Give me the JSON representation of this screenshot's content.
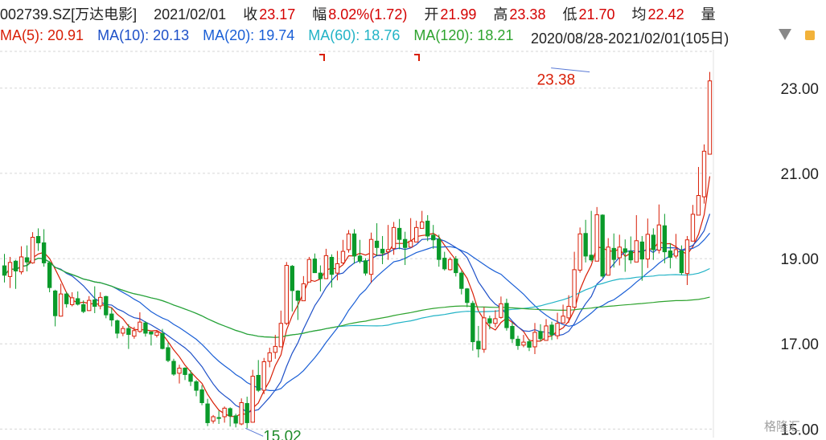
{
  "header": {
    "symbol": "002739.SZ[万达电影]",
    "date": "2021/02/01",
    "close_label": "收",
    "close": "23.17",
    "change_label": "幅",
    "change": "8.02%(1.72)",
    "open_label": "开",
    "open": "21.99",
    "high_label": "高",
    "high": "23.38",
    "low_label": "低",
    "low": "21.70",
    "avg_label": "均",
    "avg": "22.42",
    "volume_label": "量"
  },
  "moving_averages": [
    {
      "label": "MA(5):",
      "value": "20.91",
      "color": "#d81e06"
    },
    {
      "label": "MA(10):",
      "value": "20.13",
      "color": "#1e50c8"
    },
    {
      "label": "MA(20):",
      "value": "19.74",
      "color": "#1a5fd6"
    },
    {
      "label": "MA(60):",
      "value": "18.76",
      "color": "#22b3c6"
    },
    {
      "label": "MA(120):",
      "value": "18.21",
      "color": "#2ea32e"
    }
  ],
  "range": {
    "text": "2020/08/28-2021/02/01(105日)"
  },
  "watermark": "格隆汇",
  "chart_data": {
    "type": "candlestick",
    "y_ticks": [
      "23.00",
      "21.00",
      "19.00",
      "17.00",
      "15.00"
    ],
    "ylim": [
      14.8,
      23.9
    ],
    "colors": {
      "up": "#d81e06",
      "down": "#0a9a2a",
      "grid": "#d6d6d6",
      "axis": "#222222"
    },
    "annotations": [
      {
        "text": "23.38",
        "type": "high",
        "color": "#d81e06",
        "index": 104,
        "value": 23.38
      },
      {
        "text": "15.02",
        "type": "low",
        "color": "#1f8b2a",
        "index": 43,
        "value": 15.02
      }
    ],
    "candles": [
      [
        18.83,
        18.61,
        19.11,
        18.44
      ],
      [
        18.58,
        18.91,
        19.04,
        18.31
      ],
      [
        18.94,
        18.71,
        18.97,
        18.29
      ],
      [
        18.69,
        19.04,
        19.29,
        18.63
      ],
      [
        19.02,
        18.92,
        19.31,
        18.7
      ],
      [
        18.9,
        19.5,
        19.62,
        18.88
      ],
      [
        19.52,
        19.37,
        19.71,
        19.18
      ],
      [
        19.37,
        18.9,
        19.69,
        18.81
      ],
      [
        18.9,
        18.32,
        18.94,
        18.21
      ],
      [
        18.24,
        17.66,
        18.27,
        17.41
      ],
      [
        17.65,
        18.17,
        18.41,
        17.64
      ],
      [
        18.17,
        17.94,
        18.22,
        17.85
      ],
      [
        17.92,
        18.08,
        18.21,
        17.88
      ],
      [
        18.06,
        17.93,
        18.23,
        17.9
      ],
      [
        17.92,
        17.76,
        18.02,
        17.72
      ],
      [
        17.78,
        18.02,
        18.12,
        17.77
      ],
      [
        18.03,
        17.88,
        18.35,
        17.72
      ],
      [
        17.89,
        18.09,
        18.21,
        17.81
      ],
      [
        18.11,
        17.68,
        18.13,
        17.6
      ],
      [
        17.7,
        17.56,
        17.85,
        17.41
      ],
      [
        17.54,
        17.25,
        17.57,
        17.13
      ],
      [
        17.25,
        17.36,
        17.42,
        17.18
      ],
      [
        17.36,
        17.22,
        17.46,
        16.88
      ],
      [
        17.18,
        17.31,
        17.4,
        17.12
      ],
      [
        17.29,
        17.51,
        17.74,
        17.26
      ],
      [
        17.49,
        17.25,
        17.53,
        17.17
      ],
      [
        17.28,
        17.23,
        17.26,
        16.96
      ],
      [
        17.2,
        17.27,
        17.31,
        17.15
      ],
      [
        17.24,
        16.89,
        17.35,
        16.87
      ],
      [
        16.91,
        16.61,
        17.03,
        16.57
      ],
      [
        16.59,
        16.29,
        16.65,
        16.25
      ],
      [
        16.31,
        16.43,
        16.51,
        16.07
      ],
      [
        16.43,
        16.28,
        16.45,
        16.15
      ],
      [
        16.29,
        16.12,
        16.38,
        16.01
      ],
      [
        16.11,
        15.91,
        16.15,
        15.77
      ],
      [
        15.92,
        15.62,
        16.03,
        15.56
      ],
      [
        15.59,
        15.15,
        15.71,
        15.07
      ],
      [
        15.19,
        15.29,
        15.33,
        15.13
      ],
      [
        15.27,
        15.25,
        15.43,
        15.12
      ],
      [
        15.29,
        15.49,
        15.53,
        15.15
      ],
      [
        15.48,
        15.31,
        15.51,
        15.06
      ],
      [
        15.31,
        15.14,
        15.36,
        15.04
      ],
      [
        15.12,
        15.62,
        15.72,
        15.09
      ],
      [
        15.6,
        15.15,
        15.76,
        15.02
      ],
      [
        15.16,
        16.24,
        16.39,
        15.19
      ],
      [
        16.26,
        15.91,
        16.62,
        15.87
      ],
      [
        15.91,
        16.58,
        16.67,
        15.82
      ],
      [
        16.59,
        16.79,
        16.91,
        16.45
      ],
      [
        16.8,
        16.94,
        17.21,
        16.65
      ],
      [
        16.93,
        17.48,
        17.78,
        16.93
      ],
      [
        17.48,
        18.84,
        18.92,
        17.44
      ],
      [
        18.82,
        18.25,
        18.85,
        17.76
      ],
      [
        18.24,
        18.02,
        18.26,
        17.56
      ],
      [
        18.01,
        18.41,
        18.59,
        18.14
      ],
      [
        18.45,
        18.98,
        19.04,
        18.58
      ],
      [
        18.99,
        18.67,
        19.12,
        18.67
      ],
      [
        18.66,
        18.53,
        18.84,
        18.23
      ],
      [
        18.53,
        19.07,
        19.23,
        18.62
      ],
      [
        19.03,
        18.63,
        19.1,
        18.32
      ],
      [
        18.66,
        18.88,
        19.18,
        18.49
      ],
      [
        18.9,
        19.17,
        19.44,
        18.88
      ],
      [
        19.21,
        19.58,
        19.67,
        19.14
      ],
      [
        19.58,
        19.06,
        19.69,
        18.88
      ],
      [
        19.06,
        18.94,
        19.44,
        18.89
      ],
      [
        18.95,
        18.66,
        19.01,
        18.6
      ],
      [
        18.63,
        19.45,
        19.61,
        18.43
      ],
      [
        19.41,
        19.26,
        19.83,
        19.06
      ],
      [
        19.22,
        19.13,
        19.53,
        18.87
      ],
      [
        19.16,
        19.21,
        19.79,
        18.97
      ],
      [
        19.24,
        19.73,
        19.86,
        19.09
      ],
      [
        19.71,
        19.45,
        19.93,
        19.22
      ],
      [
        19.45,
        19.26,
        19.63,
        18.85
      ],
      [
        19.27,
        19.41,
        19.95,
        19.32
      ],
      [
        19.39,
        19.73,
        19.89,
        19.38
      ],
      [
        19.71,
        19.86,
        20.12,
        19.79
      ],
      [
        19.88,
        19.53,
        20.02,
        19.41
      ],
      [
        19.55,
        19.44,
        19.79,
        19.23
      ],
      [
        19.45,
        18.98,
        19.56,
        18.81
      ],
      [
        19.01,
        18.76,
        19.16,
        18.72
      ],
      [
        18.74,
        18.98,
        19.03,
        18.72
      ],
      [
        18.99,
        18.67,
        19.06,
        18.58
      ],
      [
        18.66,
        18.3,
        18.71,
        18.16
      ],
      [
        18.29,
        17.97,
        18.31,
        17.86
      ],
      [
        17.95,
        17.05,
        18.01,
        16.84
      ],
      [
        17.06,
        16.88,
        17.42,
        16.68
      ],
      [
        16.87,
        17.61,
        17.86,
        16.79
      ],
      [
        17.59,
        17.49,
        17.66,
        17.34
      ],
      [
        17.48,
        17.59,
        17.79,
        17.39
      ],
      [
        17.62,
        17.94,
        18.11,
        17.59
      ],
      [
        17.95,
        17.38,
        18.06,
        17.31
      ],
      [
        17.41,
        17.12,
        17.5,
        17.02
      ],
      [
        17.11,
        16.96,
        17.19,
        16.86
      ],
      [
        16.97,
        17.04,
        17.21,
        16.92
      ],
      [
        17.05,
        16.92,
        17.11,
        16.83
      ],
      [
        16.93,
        17.27,
        17.49,
        16.76
      ],
      [
        17.29,
        17.12,
        17.46,
        17.06
      ],
      [
        17.08,
        17.42,
        17.58,
        17.19
      ],
      [
        17.44,
        17.21,
        17.52,
        17.09
      ],
      [
        17.19,
        17.48,
        17.73,
        17.11
      ],
      [
        17.49,
        17.65,
        17.92,
        17.48
      ],
      [
        17.61,
        17.88,
        18.14,
        17.49
      ],
      [
        17.86,
        18.74,
        19.16,
        17.98
      ],
      [
        18.73,
        19.58,
        19.73,
        18.67
      ],
      [
        19.59,
        19.06,
        19.91,
        18.91
      ],
      [
        19.08,
        18.97,
        20.12,
        18.93
      ],
      [
        18.94,
        20.03,
        20.21,
        18.99
      ],
      [
        20.02,
        18.59,
        20.04,
        18.55
      ],
      [
        18.61,
        19.27,
        19.48,
        18.94
      ],
      [
        19.24,
        18.98,
        19.59,
        18.79
      ],
      [
        19.02,
        19.27,
        19.56,
        18.84
      ],
      [
        19.23,
        19.15,
        19.45,
        18.69
      ],
      [
        19.17,
        18.97,
        19.52,
        18.88
      ],
      [
        18.92,
        19.42,
        20.02,
        19.06
      ],
      [
        19.39,
        18.99,
        19.53,
        18.48
      ],
      [
        18.99,
        19.57,
        19.94,
        18.78
      ],
      [
        19.55,
        19.21,
        19.71,
        18.97
      ],
      [
        19.2,
        19.79,
        20.27,
        19.12
      ],
      [
        19.77,
        19.16,
        20.05,
        18.89
      ],
      [
        19.18,
        19.03,
        19.36,
        18.77
      ],
      [
        19.06,
        19.21,
        19.58,
        19.01
      ],
      [
        19.18,
        18.67,
        19.31,
        18.62
      ],
      [
        18.65,
        19.44,
        19.53,
        18.38
      ],
      [
        19.41,
        20.04,
        20.26,
        19.71
      ],
      [
        20.02,
        20.48,
        21.15,
        20.07
      ],
      [
        20.45,
        21.52,
        21.68,
        20.29
      ],
      [
        21.45,
        23.17,
        23.38,
        21.7
      ]
    ]
  }
}
